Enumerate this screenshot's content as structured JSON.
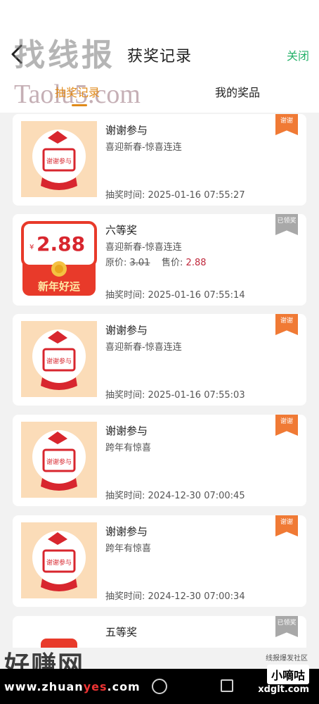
{
  "header": {
    "title": "获奖记录",
    "close_label": "关闭"
  },
  "tabs": [
    {
      "label": "抽奖记录",
      "active": true
    },
    {
      "label": "我的奖品",
      "active": false
    }
  ],
  "records": [
    {
      "prize": "谢谢参与",
      "activity": "喜迎新春-惊喜连连",
      "time_label": "抽奖时间:",
      "time": "2025-01-16 07:55:27",
      "tag": "谢谢",
      "thumb": "thanks",
      "price": null
    },
    {
      "prize": "六等奖",
      "activity": "喜迎新春-惊喜连连",
      "time_label": "抽奖时间:",
      "time": "2025-01-16 07:55:14",
      "tag": "已领奖",
      "thumb": "red-packet",
      "price": {
        "orig_label": "原价:",
        "orig": "3.01",
        "sale_label": "售价:",
        "sale": "2.88"
      }
    },
    {
      "prize": "谢谢参与",
      "activity": "喜迎新春-惊喜连连",
      "time_label": "抽奖时间:",
      "time": "2025-01-16 07:55:03",
      "tag": "谢谢",
      "thumb": "thanks",
      "price": null
    },
    {
      "prize": "谢谢参与",
      "activity": "跨年有惊喜",
      "time_label": "抽奖时间:",
      "time": "2024-12-30 07:00:45",
      "tag": "谢谢",
      "thumb": "thanks",
      "price": null
    },
    {
      "prize": "谢谢参与",
      "activity": "跨年有惊喜",
      "time_label": "抽奖时间:",
      "time": "2024-12-30 07:00:34",
      "tag": "谢谢",
      "thumb": "thanks",
      "price": null
    },
    {
      "prize": "五等奖",
      "tag": "已领奖",
      "thumb": "red-packet-partial"
    }
  ],
  "red_packet": {
    "currency": "¥",
    "amount": "2.88",
    "caption": "新年好运"
  },
  "thanks_thumb_text": "谢谢参与",
  "watermarks": {
    "top": "找线报",
    "taolu": "Taolu5.com",
    "bottom": "好赚网",
    "bottom_url_pre": "www.zhuan",
    "bottom_url_hl": "yes",
    "bottom_url_post": ".com",
    "badge": "小嘀咕",
    "badge_small": "线报爆发社区",
    "domain": "xdglt.com"
  },
  "colors": {
    "accent_green": "#26b26a",
    "tab_active": "#e08a1a",
    "ribbon_orange": "#f07a35",
    "ribbon_gray": "#a8a8a8",
    "sale_red": "#c0283c"
  },
  "icons": {
    "back": "chevron-left-icon",
    "nav_home": "circle-icon",
    "nav_recent": "square-icon"
  }
}
